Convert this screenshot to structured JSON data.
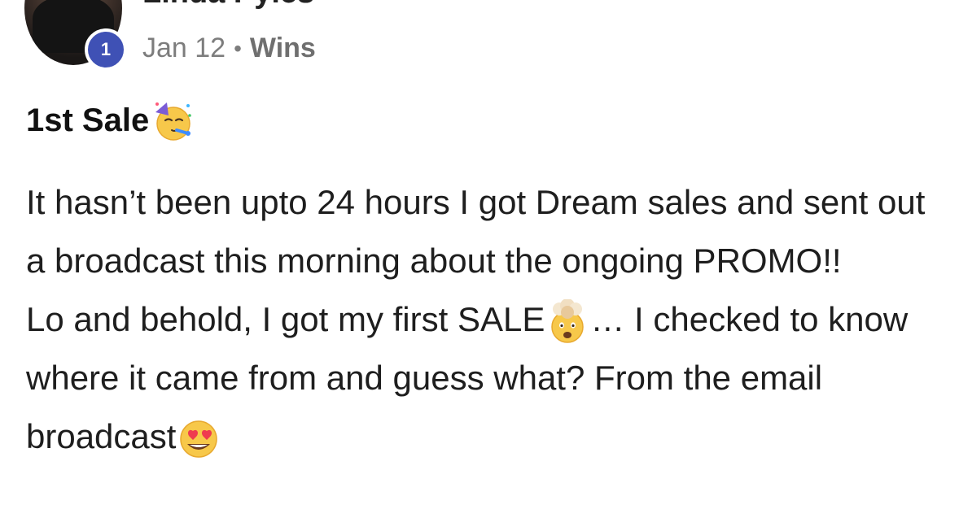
{
  "author": {
    "name": "Linda Pyles",
    "level": "1"
  },
  "meta": {
    "date": "Jan 12",
    "separator": "•",
    "category": "Wins"
  },
  "post": {
    "title": "1st Sale",
    "title_emoji": "partying-face-icon",
    "paragraph1": "It hasn’t been upto 24 hours I got Dream sales and sent out a broadcast this morning about the ongoing PROMO!!",
    "paragraph2_part1": "Lo and behold, I got my first SALE",
    "paragraph2_emoji1": "exploding-head-icon",
    "paragraph2_part2": "… I checked to know where it came from and guess what? From the email broadcast",
    "paragraph2_emoji2": "heart-eyes-icon"
  },
  "colors": {
    "badge": "#3f51b5",
    "meta_text": "#7d7d7d",
    "body_text": "#1e1e1e"
  }
}
